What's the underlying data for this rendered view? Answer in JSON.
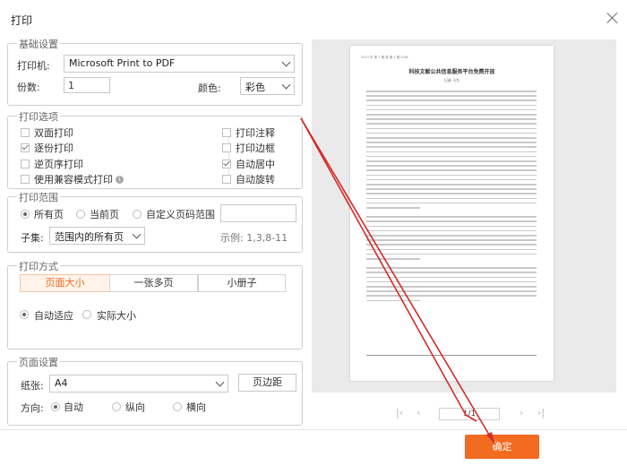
{
  "window": {
    "title": "打印"
  },
  "basic": {
    "legend": "基础设置",
    "printer_label": "打印机:",
    "printer_value": "Microsoft Print to PDF",
    "copies_label": "份数:",
    "copies_value": "1",
    "color_label": "颜色:",
    "color_value": "彩色"
  },
  "options": {
    "legend": "打印选项",
    "left": [
      {
        "label": "双面打印",
        "checked": false
      },
      {
        "label": "逐份打印",
        "checked": true
      },
      {
        "label": "逆页序打印",
        "checked": false
      },
      {
        "label": "使用兼容模式打印",
        "checked": false
      }
    ],
    "right": [
      {
        "label": "打印注释",
        "checked": false
      },
      {
        "label": "打印边框",
        "checked": false
      },
      {
        "label": "自动居中",
        "checked": true
      },
      {
        "label": "自动旋转",
        "checked": false
      }
    ],
    "info_icon": "i"
  },
  "range": {
    "legend": "打印范围",
    "radios": [
      "所有页",
      "当前页",
      "自定义页码范围"
    ],
    "selected": 0,
    "subset_label": "子集:",
    "subset_value": "范围内的所有页",
    "example": "示例: 1,3,8-11"
  },
  "mode": {
    "legend": "打印方式",
    "tabs": [
      "页面大小",
      "一张多页",
      "小册子"
    ],
    "active_tab": 0,
    "radios": [
      "自动适应",
      "实际大小"
    ],
    "selected": 0
  },
  "page_setup": {
    "legend": "页面设置",
    "paper_label": "纸张:",
    "paper_value": "A4",
    "margin_button": "页边距",
    "orientation_label": "方向:",
    "radios": [
      "自动",
      "纵向",
      "横向"
    ],
    "selected": 0
  },
  "preview": {
    "header": "2023 年 第 1 期   卷 第 1 期   ISSN",
    "title": "科技文献公共信息服务平台免费开放",
    "author": "记者    马冬",
    "page_indicator": "1/1"
  },
  "footer": {
    "confirm": "确定"
  },
  "colors": {
    "accent": "#f36a21",
    "arrow": "#d42a2a"
  }
}
